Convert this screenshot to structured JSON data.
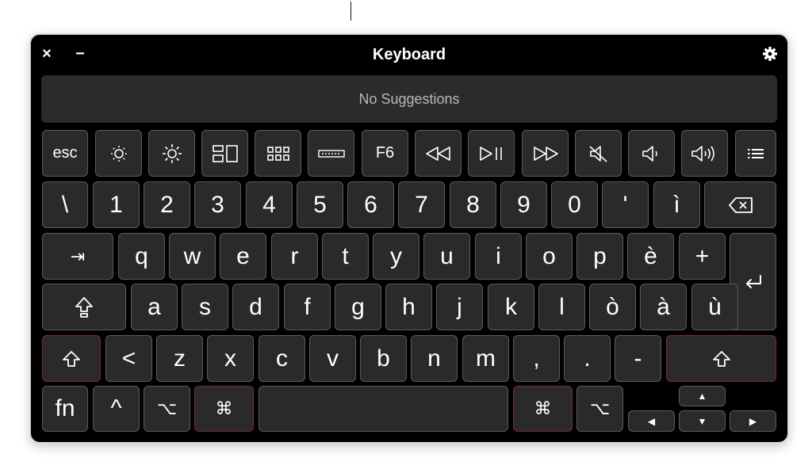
{
  "window": {
    "title": "Keyboard",
    "close_icon": "×",
    "minimize_icon": "−",
    "settings_icon": "gear-icon"
  },
  "suggestions": {
    "text": "No Suggestions"
  },
  "function_row": {
    "esc": "esc",
    "f6": "F6",
    "icons": [
      "brightness-down-icon",
      "brightness-up-icon",
      "mission-control-icon",
      "launchpad-icon",
      "keyboard-brightness-icon",
      "rewind-icon",
      "play-pause-icon",
      "fast-forward-icon",
      "mute-icon",
      "volume-down-icon",
      "volume-up-icon",
      "list-icon"
    ]
  },
  "number_row": [
    "\\",
    "1",
    "2",
    "3",
    "4",
    "5",
    "6",
    "7",
    "8",
    "9",
    "0",
    "'",
    "ì"
  ],
  "qwerty_row": [
    "q",
    "w",
    "e",
    "r",
    "t",
    "y",
    "u",
    "i",
    "o",
    "p",
    "è",
    "+"
  ],
  "home_row": [
    "a",
    "s",
    "d",
    "f",
    "g",
    "h",
    "j",
    "k",
    "l",
    "ò",
    "à",
    "ù"
  ],
  "bottom_letters": [
    "<",
    "z",
    "x",
    "c",
    "v",
    "b",
    "n",
    "m",
    ",",
    ".",
    "-"
  ],
  "symbols": {
    "tab": "⇥",
    "caps_lock": "⇪",
    "shift": "⇧",
    "return": "⏎",
    "fn": "fn",
    "control": "^",
    "option": "⌥",
    "command": "⌘",
    "arrow_up": "▲",
    "arrow_down": "▼",
    "arrow_left": "◀",
    "arrow_right": "▶"
  },
  "colors": {
    "window_bg": "#000000",
    "key_bg": "#2a2a2a",
    "key_border": "#5b5b5b",
    "key_border_highlight": "#7a2d2d",
    "suggest_bg": "#2b2b2b"
  }
}
